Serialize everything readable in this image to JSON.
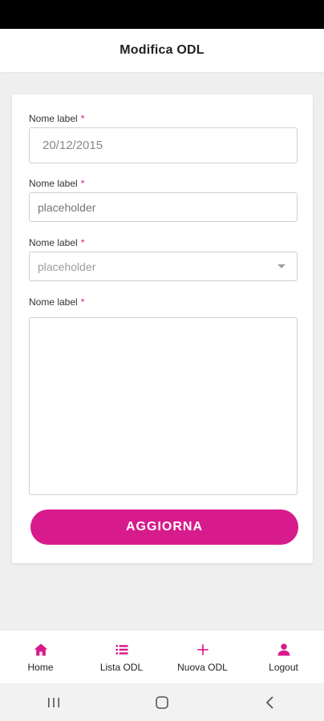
{
  "header": {
    "title": "Modifica ODL"
  },
  "form": {
    "required_marker": "*",
    "fields": [
      {
        "label": "Nome label",
        "value": "20/12/2015"
      },
      {
        "label": "Nome label",
        "placeholder": "placeholder"
      },
      {
        "label": "Nome label",
        "selected": "placeholder"
      },
      {
        "label": "Nome label",
        "value": ""
      }
    ],
    "submit_label": "AGGIORNA"
  },
  "bottom_nav": [
    {
      "label": "Home",
      "icon": "home-icon"
    },
    {
      "label": "Lista ODL",
      "icon": "list-icon"
    },
    {
      "label": "Nuova ODL",
      "icon": "plus-icon"
    },
    {
      "label": "Logout",
      "icon": "user-icon"
    }
  ],
  "colors": {
    "accent": "#d81b8c",
    "background": "#efefef"
  }
}
